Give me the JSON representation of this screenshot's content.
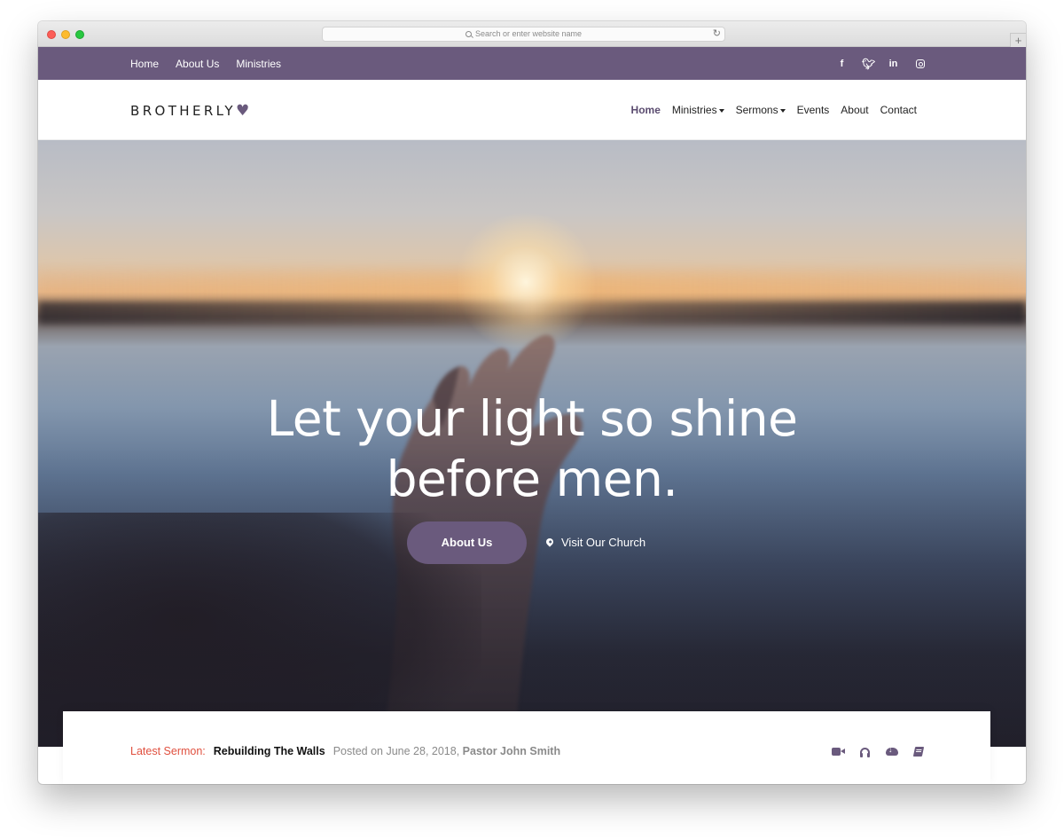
{
  "browser": {
    "address_placeholder": "Search or enter website name"
  },
  "topbar": {
    "links": [
      "Home",
      "About Us",
      "Ministries"
    ],
    "social": [
      "f",
      "t",
      "in",
      "instagram"
    ]
  },
  "header": {
    "logo_text": "BROTHERLY",
    "logo_heart": "♥",
    "nav": {
      "home": "Home",
      "ministries": "Ministries",
      "sermons": "Sermons",
      "events": "Events",
      "about": "About",
      "contact": "Contact"
    }
  },
  "hero": {
    "title_line1": "Let your light so shine",
    "title_line2": "before men.",
    "primary_button": "About Us",
    "secondary_link": "Visit Our Church"
  },
  "sermon": {
    "label": "Latest Sermon:",
    "title": "Rebuilding The Walls",
    "posted_prefix": "Posted on June 28, 2018,",
    "author": "Pastor John Smith",
    "icons": [
      "video-icon",
      "headphones-icon",
      "cloud-download-icon",
      "book-icon"
    ]
  },
  "colors": {
    "brand_purple": "#6a5a7d",
    "accent_red": "#e0503f"
  }
}
